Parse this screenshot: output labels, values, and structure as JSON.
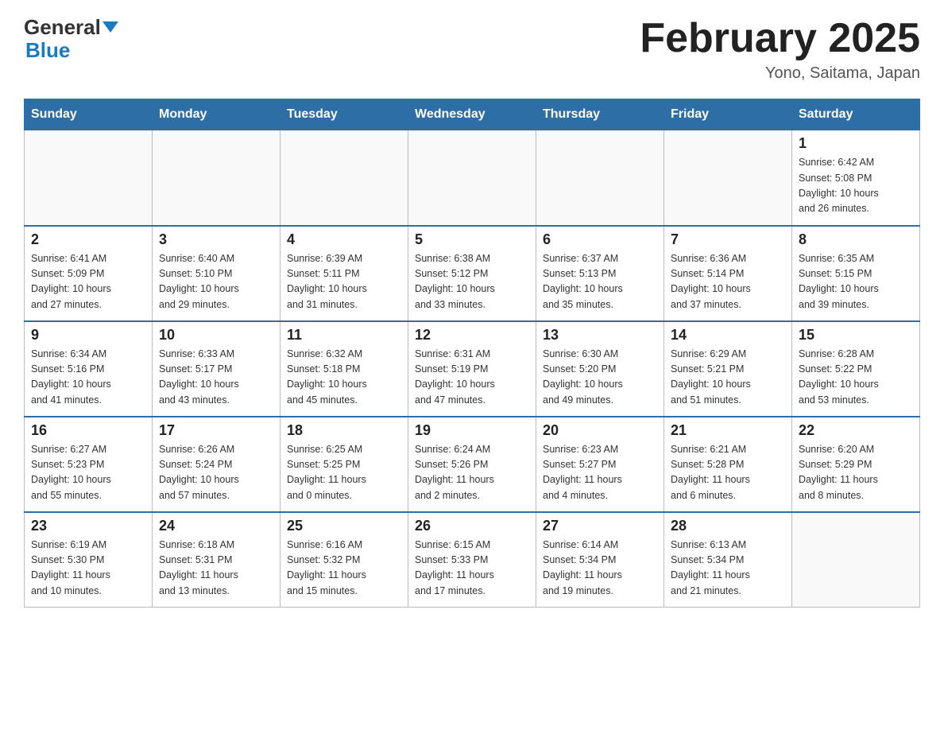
{
  "header": {
    "logo_general": "General",
    "logo_blue": "Blue",
    "month_title": "February 2025",
    "location": "Yono, Saitama, Japan"
  },
  "weekdays": [
    "Sunday",
    "Monday",
    "Tuesday",
    "Wednesday",
    "Thursday",
    "Friday",
    "Saturday"
  ],
  "weeks": [
    {
      "days": [
        {
          "num": "",
          "info": ""
        },
        {
          "num": "",
          "info": ""
        },
        {
          "num": "",
          "info": ""
        },
        {
          "num": "",
          "info": ""
        },
        {
          "num": "",
          "info": ""
        },
        {
          "num": "",
          "info": ""
        },
        {
          "num": "1",
          "info": "Sunrise: 6:42 AM\nSunset: 5:08 PM\nDaylight: 10 hours\nand 26 minutes."
        }
      ]
    },
    {
      "days": [
        {
          "num": "2",
          "info": "Sunrise: 6:41 AM\nSunset: 5:09 PM\nDaylight: 10 hours\nand 27 minutes."
        },
        {
          "num": "3",
          "info": "Sunrise: 6:40 AM\nSunset: 5:10 PM\nDaylight: 10 hours\nand 29 minutes."
        },
        {
          "num": "4",
          "info": "Sunrise: 6:39 AM\nSunset: 5:11 PM\nDaylight: 10 hours\nand 31 minutes."
        },
        {
          "num": "5",
          "info": "Sunrise: 6:38 AM\nSunset: 5:12 PM\nDaylight: 10 hours\nand 33 minutes."
        },
        {
          "num": "6",
          "info": "Sunrise: 6:37 AM\nSunset: 5:13 PM\nDaylight: 10 hours\nand 35 minutes."
        },
        {
          "num": "7",
          "info": "Sunrise: 6:36 AM\nSunset: 5:14 PM\nDaylight: 10 hours\nand 37 minutes."
        },
        {
          "num": "8",
          "info": "Sunrise: 6:35 AM\nSunset: 5:15 PM\nDaylight: 10 hours\nand 39 minutes."
        }
      ]
    },
    {
      "days": [
        {
          "num": "9",
          "info": "Sunrise: 6:34 AM\nSunset: 5:16 PM\nDaylight: 10 hours\nand 41 minutes."
        },
        {
          "num": "10",
          "info": "Sunrise: 6:33 AM\nSunset: 5:17 PM\nDaylight: 10 hours\nand 43 minutes."
        },
        {
          "num": "11",
          "info": "Sunrise: 6:32 AM\nSunset: 5:18 PM\nDaylight: 10 hours\nand 45 minutes."
        },
        {
          "num": "12",
          "info": "Sunrise: 6:31 AM\nSunset: 5:19 PM\nDaylight: 10 hours\nand 47 minutes."
        },
        {
          "num": "13",
          "info": "Sunrise: 6:30 AM\nSunset: 5:20 PM\nDaylight: 10 hours\nand 49 minutes."
        },
        {
          "num": "14",
          "info": "Sunrise: 6:29 AM\nSunset: 5:21 PM\nDaylight: 10 hours\nand 51 minutes."
        },
        {
          "num": "15",
          "info": "Sunrise: 6:28 AM\nSunset: 5:22 PM\nDaylight: 10 hours\nand 53 minutes."
        }
      ]
    },
    {
      "days": [
        {
          "num": "16",
          "info": "Sunrise: 6:27 AM\nSunset: 5:23 PM\nDaylight: 10 hours\nand 55 minutes."
        },
        {
          "num": "17",
          "info": "Sunrise: 6:26 AM\nSunset: 5:24 PM\nDaylight: 10 hours\nand 57 minutes."
        },
        {
          "num": "18",
          "info": "Sunrise: 6:25 AM\nSunset: 5:25 PM\nDaylight: 11 hours\nand 0 minutes."
        },
        {
          "num": "19",
          "info": "Sunrise: 6:24 AM\nSunset: 5:26 PM\nDaylight: 11 hours\nand 2 minutes."
        },
        {
          "num": "20",
          "info": "Sunrise: 6:23 AM\nSunset: 5:27 PM\nDaylight: 11 hours\nand 4 minutes."
        },
        {
          "num": "21",
          "info": "Sunrise: 6:21 AM\nSunset: 5:28 PM\nDaylight: 11 hours\nand 6 minutes."
        },
        {
          "num": "22",
          "info": "Sunrise: 6:20 AM\nSunset: 5:29 PM\nDaylight: 11 hours\nand 8 minutes."
        }
      ]
    },
    {
      "days": [
        {
          "num": "23",
          "info": "Sunrise: 6:19 AM\nSunset: 5:30 PM\nDaylight: 11 hours\nand 10 minutes."
        },
        {
          "num": "24",
          "info": "Sunrise: 6:18 AM\nSunset: 5:31 PM\nDaylight: 11 hours\nand 13 minutes."
        },
        {
          "num": "25",
          "info": "Sunrise: 6:16 AM\nSunset: 5:32 PM\nDaylight: 11 hours\nand 15 minutes."
        },
        {
          "num": "26",
          "info": "Sunrise: 6:15 AM\nSunset: 5:33 PM\nDaylight: 11 hours\nand 17 minutes."
        },
        {
          "num": "27",
          "info": "Sunrise: 6:14 AM\nSunset: 5:34 PM\nDaylight: 11 hours\nand 19 minutes."
        },
        {
          "num": "28",
          "info": "Sunrise: 6:13 AM\nSunset: 5:34 PM\nDaylight: 11 hours\nand 21 minutes."
        },
        {
          "num": "",
          "info": ""
        }
      ]
    }
  ]
}
